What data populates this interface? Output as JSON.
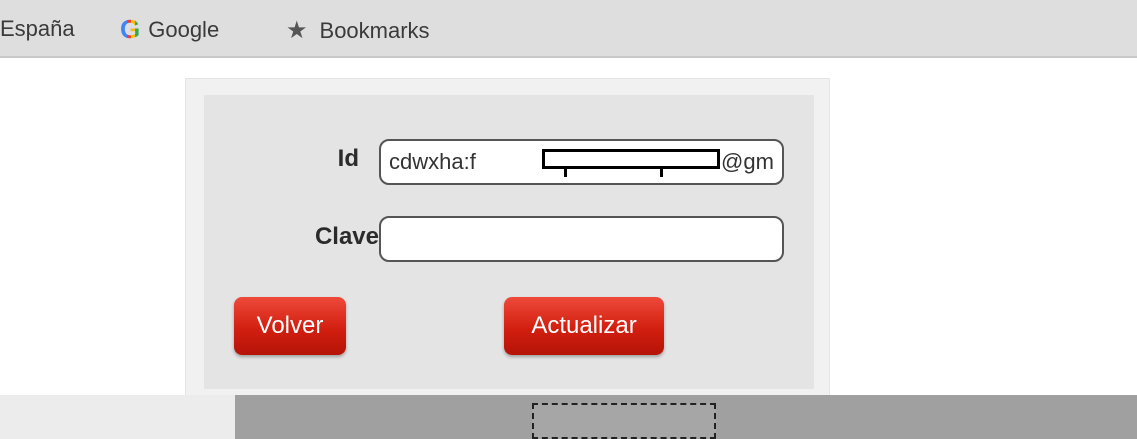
{
  "bookmarks_bar": {
    "items": [
      {
        "label": "España"
      },
      {
        "label": "Google",
        "icon": "google-g-icon"
      },
      {
        "label": "Bookmarks",
        "icon": "star-icon"
      }
    ]
  },
  "form": {
    "id_label": "Id",
    "id_value": "cdwxha:f",
    "id_suffix": "@gm",
    "clave_label": "Clave",
    "clave_value": "",
    "volver_label": "Volver",
    "actualizar_label": "Actualizar"
  },
  "colors": {
    "button_red": "#d21f10",
    "panel_bg": "#e4e4e4",
    "bookmarks_bg": "#dedede"
  }
}
